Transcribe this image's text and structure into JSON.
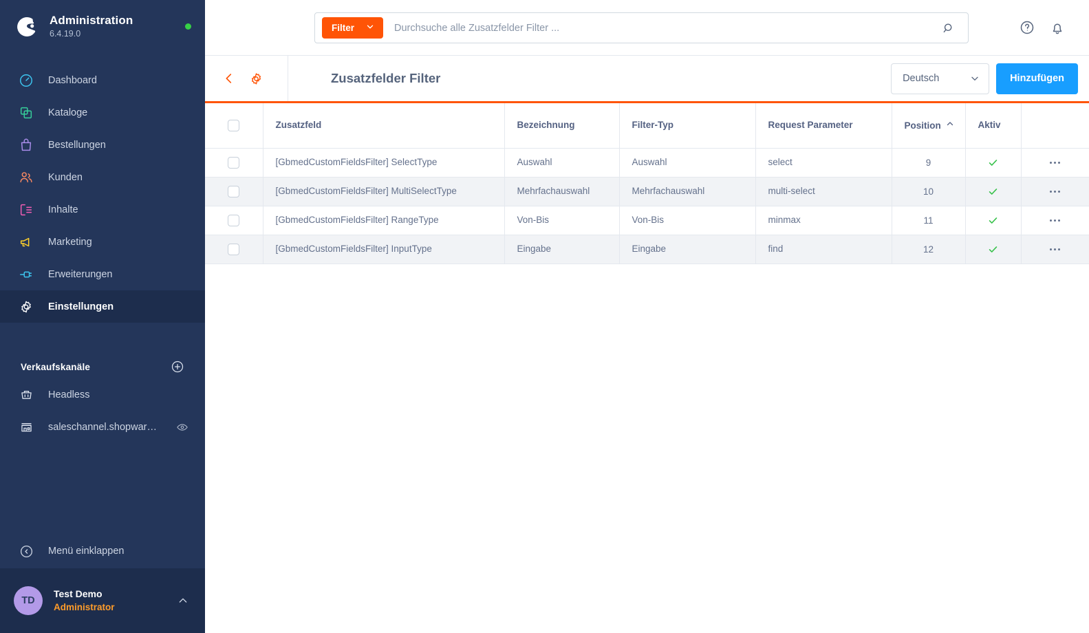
{
  "sidebar": {
    "brand": {
      "title": "Administration",
      "version": "6.4.19.0",
      "status_color": "#37d046"
    },
    "nav": [
      {
        "label": "Dashboard",
        "icon": "speedometer-icon",
        "color": "#3dc6f0",
        "active": false
      },
      {
        "label": "Kataloge",
        "icon": "catalog-icon",
        "color": "#37d09a",
        "active": false
      },
      {
        "label": "Bestellungen",
        "icon": "bag-icon",
        "color": "#a98dea",
        "active": false
      },
      {
        "label": "Kunden",
        "icon": "users-icon",
        "color": "#f88962",
        "active": false
      },
      {
        "label": "Inhalte",
        "icon": "content-icon",
        "color": "#f45eb4",
        "active": false
      },
      {
        "label": "Marketing",
        "icon": "megaphone-icon",
        "color": "#ffd12b",
        "active": false
      },
      {
        "label": "Erweiterungen",
        "icon": "plug-icon",
        "color": "#3dc6f0",
        "active": false
      },
      {
        "label": "Einstellungen",
        "icon": "gear-icon",
        "color": "#ffffff",
        "active": true
      }
    ],
    "channels": {
      "title": "Verkaufskanäle",
      "add_label": "add-sales-channel",
      "items": [
        {
          "label": "Headless",
          "icon": "basket-icon",
          "has_eye": false
        },
        {
          "label": "saleschannel.shopware.co…",
          "icon": "storefront-icon",
          "has_eye": true
        }
      ]
    },
    "collapse_label": "Menü einklappen",
    "user": {
      "initials": "TD",
      "name": "Test Demo",
      "role": "Administrator",
      "avatar_color": "#b39ae8"
    }
  },
  "topbar": {
    "filter_label": "Filter",
    "search_placeholder": "Durchsuche alle Zusatzfelder Filter ...",
    "search_value": "",
    "help_icon": "help-circle-icon",
    "bell_icon": "bell-icon"
  },
  "pagehead": {
    "back_icon": "chevron-left-icon",
    "settings_icon": "gear-icon",
    "title": "Zusatzfelder Filter",
    "language": "Deutsch",
    "add_button": "Hinzufügen",
    "accent_color": "#ff5406",
    "add_button_color": "#189eff"
  },
  "table": {
    "columns": [
      {
        "key": "select",
        "label": ""
      },
      {
        "key": "field",
        "label": "Zusatzfeld"
      },
      {
        "key": "bez",
        "label": "Bezeichnung"
      },
      {
        "key": "ftype",
        "label": "Filter-Typ"
      },
      {
        "key": "request",
        "label": "Request Parameter"
      },
      {
        "key": "position",
        "label": "Position",
        "sort": "asc"
      },
      {
        "key": "active",
        "label": "Aktiv"
      },
      {
        "key": "actions",
        "label": ""
      }
    ],
    "rows": [
      {
        "field": "[GbmedCustomFieldsFilter] SelectType",
        "bez": "Auswahl",
        "ftype": "Auswahl",
        "request": "select",
        "position": "9",
        "active": true
      },
      {
        "field": "[GbmedCustomFieldsFilter] MultiSelectType",
        "bez": "Mehrfachauswahl",
        "ftype": "Mehrfachauswahl",
        "request": "multi-select",
        "position": "10",
        "active": true
      },
      {
        "field": "[GbmedCustomFieldsFilter] RangeType",
        "bez": "Von-Bis",
        "ftype": "Von-Bis",
        "request": "minmax",
        "position": "11",
        "active": true
      },
      {
        "field": "[GbmedCustomFieldsFilter] InputType",
        "bez": "Eingabe",
        "ftype": "Eingabe",
        "request": "find",
        "position": "12",
        "active": true
      }
    ],
    "active_check_color": "#37c14a",
    "row_alt_color": "#f1f3f6"
  }
}
